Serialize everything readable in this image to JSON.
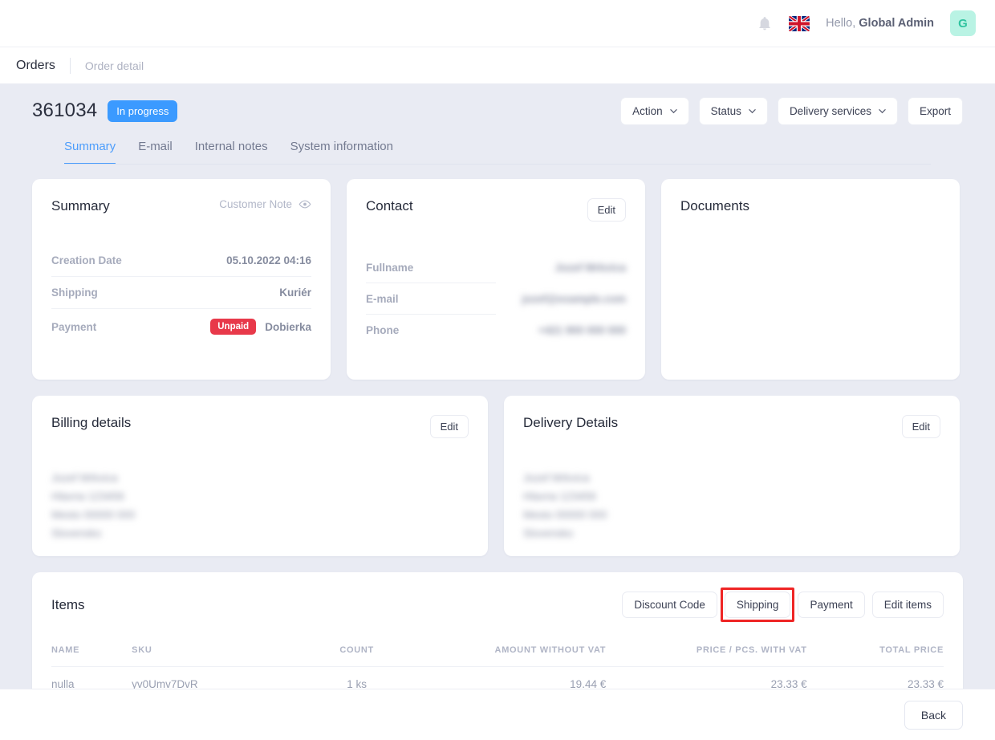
{
  "topbar": {
    "notifications_icon": "bell-icon",
    "language_icon": "uk-flag-icon",
    "greeting_prefix": "Hello, ",
    "user_name": "Global Admin",
    "avatar_initial": "G"
  },
  "breadcrumb": {
    "current": "Orders",
    "sub": "Order detail"
  },
  "order": {
    "id": "361034",
    "status": "In progress",
    "status_color": "#3b9aff"
  },
  "head_actions": [
    {
      "label": "Action",
      "caret": true
    },
    {
      "label": "Status",
      "caret": true
    },
    {
      "label": "Delivery services",
      "caret": true
    },
    {
      "label": "Export",
      "caret": false
    }
  ],
  "tabs": [
    {
      "label": "Summary",
      "active": true
    },
    {
      "label": "E-mail",
      "active": false
    },
    {
      "label": "Internal notes",
      "active": false
    },
    {
      "label": "System information",
      "active": false
    }
  ],
  "summary_card": {
    "title": "Summary",
    "note_label": "Customer Note",
    "note_icon": "eye-icon",
    "rows": [
      {
        "key": "Creation Date",
        "value": "05.10.2022 04:16"
      },
      {
        "key": "Shipping",
        "value": "Kuriér"
      },
      {
        "key": "Payment",
        "badge": "Unpaid",
        "badge_color": "#e8394a",
        "value": "Dobierka"
      }
    ]
  },
  "contact_card": {
    "title": "Contact",
    "edit_label": "Edit",
    "rows": [
      {
        "key": "Fullname",
        "value": "Jozef Mrkvica",
        "redacted": true
      },
      {
        "key": "E-mail",
        "value": "jozef@example.com",
        "redacted": true
      },
      {
        "key": "Phone",
        "value": "+421 900 000 000",
        "redacted": true
      }
    ]
  },
  "documents_card": {
    "title": "Documents"
  },
  "billing_card": {
    "title": "Billing details",
    "edit_label": "Edit",
    "lines": [
      "Jozef Mrkvica",
      "Hlavna 123456",
      "Mesto 00000 000",
      "Slovensko"
    ],
    "redacted": true
  },
  "delivery_card": {
    "title": "Delivery Details",
    "edit_label": "Edit",
    "lines": [
      "Jozef Mrkvica",
      "Hlavna 123456",
      "Mesto 00000 000",
      "Slovensko"
    ],
    "redacted": true
  },
  "items_card": {
    "title": "Items",
    "buttons": [
      {
        "label": "Discount Code",
        "highlighted": false
      },
      {
        "label": "Shipping",
        "highlighted": true
      },
      {
        "label": "Payment",
        "highlighted": false
      },
      {
        "label": "Edit items",
        "highlighted": false
      }
    ],
    "highlight_color": "#ef2525",
    "columns": [
      "NAME",
      "SKU",
      "COUNT",
      "AMOUNT WITHOUT VAT",
      "PRICE / PCS. WITH VAT",
      "TOTAL PRICE"
    ],
    "rows": [
      {
        "name": "nulla",
        "sku": "yv0Umv7DvR",
        "count": "1 ks",
        "amount_without_vat": "19.44 €",
        "price_per_pcs_with_vat": "23.33 €",
        "total_price": "23.33 €"
      }
    ]
  },
  "footer": {
    "back_label": "Back"
  }
}
